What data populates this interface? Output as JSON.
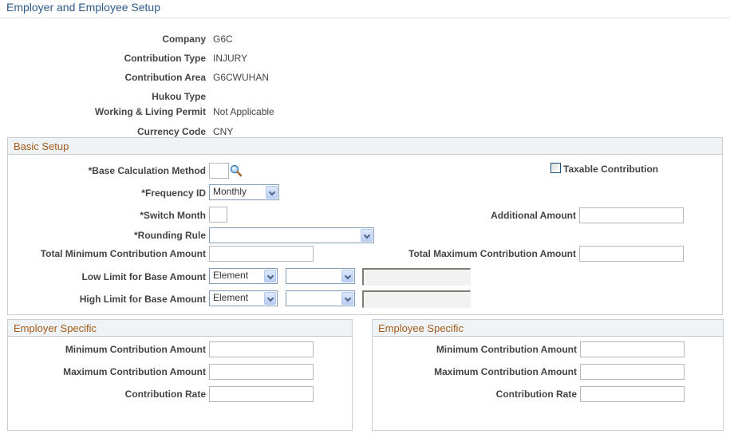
{
  "page": {
    "title": "Employer and Employee Setup"
  },
  "header_fields": [
    {
      "label": "Company",
      "value": "G6C"
    },
    {
      "label": "Contribution Type",
      "value": "INJURY"
    },
    {
      "label": "Contribution Area",
      "value": "G6CWUHAN"
    },
    {
      "label": "Hukou Type",
      "value": ""
    },
    {
      "label": "Working & Living Permit",
      "value": "Not Applicable"
    },
    {
      "label": "Currency Code",
      "value": "CNY"
    }
  ],
  "basic_setup": {
    "title": "Basic Setup",
    "base_calculation_method": {
      "label": "*Base Calculation Method",
      "value": ""
    },
    "taxable_contribution": {
      "label": "Taxable Contribution",
      "checked": false
    },
    "frequency_id": {
      "label": "*Frequency ID",
      "value": "Monthly"
    },
    "switch_month": {
      "label": "*Switch Month",
      "value": ""
    },
    "additional_amount": {
      "label": "Additional Amount",
      "value": ""
    },
    "rounding_rule": {
      "label": "*Rounding Rule",
      "value": ""
    },
    "total_min": {
      "label": "Total Minimum Contribution Amount",
      "value": ""
    },
    "total_max": {
      "label": "Total Maximum Contribution Amount",
      "value": ""
    },
    "low_limit": {
      "label": "Low Limit for Base Amount",
      "type_value": "Element",
      "element_value": "",
      "amount_value": ""
    },
    "high_limit": {
      "label": "High Limit for Base Amount",
      "type_value": "Element",
      "element_value": "",
      "amount_value": ""
    }
  },
  "employer_specific": {
    "title": "Employer Specific",
    "min_label": "Minimum Contribution Amount",
    "min_value": "",
    "max_label": "Maximum Contribution Amount",
    "max_value": "",
    "rate_label": "Contribution Rate",
    "rate_value": ""
  },
  "employee_specific": {
    "title": "Employee Specific",
    "min_label": "Minimum Contribution Amount",
    "min_value": "",
    "max_label": "Maximum Contribution Amount",
    "max_value": "",
    "rate_label": "Contribution Rate",
    "rate_value": ""
  },
  "icons": {
    "lookup": "magnifying-glass",
    "dropdown": "chevron-down",
    "checkbox": "unchecked-box"
  },
  "colors": {
    "title": "#2e5a8a",
    "group_header_text": "#a35a1b",
    "group_header_bg": "#eff3f5",
    "border": "#c9cdd1"
  }
}
